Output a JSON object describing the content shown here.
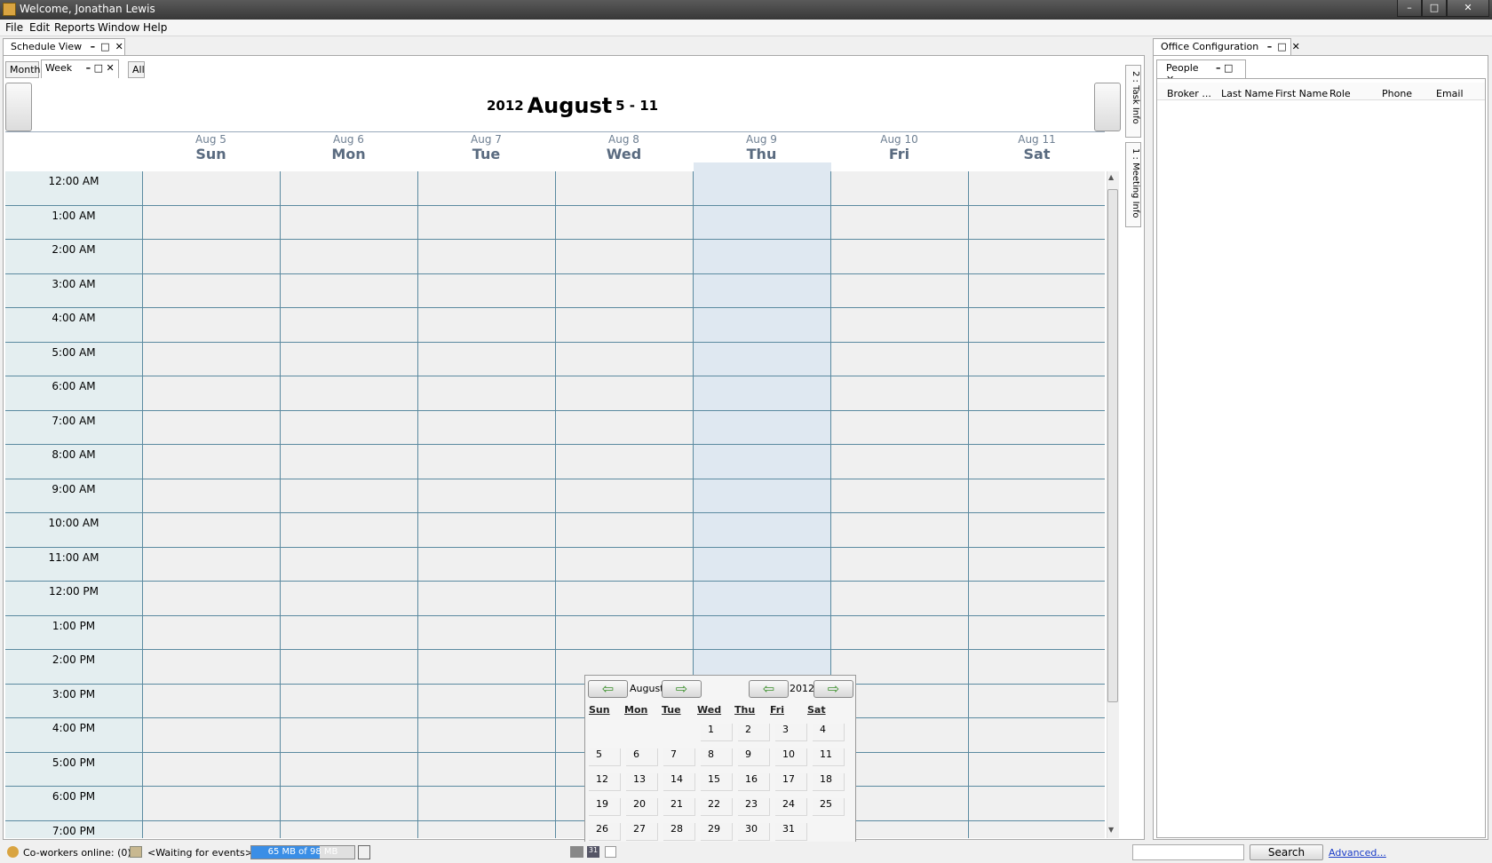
{
  "window": {
    "title": "Welcome, Jonathan Lewis",
    "controls": [
      "–",
      "□",
      "✕"
    ]
  },
  "menu": [
    "File",
    "Edit",
    "Reports",
    "Window",
    "Help"
  ],
  "schedule": {
    "tab_label": "Schedule View",
    "subtabs": [
      "Month",
      "Week",
      "All"
    ],
    "header": {
      "year": "2012",
      "month": "August",
      "range": "5 - 11"
    },
    "days": [
      {
        "date": "Aug 5",
        "weekday": "Sun"
      },
      {
        "date": "Aug 6",
        "weekday": "Mon"
      },
      {
        "date": "Aug 7",
        "weekday": "Tue"
      },
      {
        "date": "Aug 8",
        "weekday": "Wed"
      },
      {
        "date": "Aug 9",
        "weekday": "Thu"
      },
      {
        "date": "Aug 10",
        "weekday": "Fri"
      },
      {
        "date": "Aug 11",
        "weekday": "Sat"
      }
    ],
    "highlighted_day_index": 4,
    "times": [
      "12:00 AM",
      "1:00 AM",
      "2:00 AM",
      "3:00 AM",
      "4:00 AM",
      "5:00 AM",
      "6:00 AM",
      "7:00 AM",
      "8:00 AM",
      "9:00 AM",
      "10:00 AM",
      "11:00 AM",
      "12:00 PM",
      "1:00 PM",
      "2:00 PM",
      "3:00 PM",
      "4:00 PM",
      "5:00 PM",
      "6:00 PM",
      "7:00 PM"
    ],
    "side_tabs": [
      "2 : Task Info",
      "1 : Meeting Info"
    ]
  },
  "minical": {
    "month": "August",
    "year": "2012",
    "dow": [
      "Sun",
      "Mon",
      "Tue",
      "Wed",
      "Thu",
      "Fri",
      "Sat"
    ],
    "weeks": [
      [
        "",
        "",
        "",
        "1",
        "2",
        "3",
        "4"
      ],
      [
        "5",
        "6",
        "7",
        "8",
        "9",
        "10",
        "11"
      ],
      [
        "12",
        "13",
        "14",
        "15",
        "16",
        "17",
        "18"
      ],
      [
        "19",
        "20",
        "21",
        "22",
        "23",
        "24",
        "25"
      ],
      [
        "26",
        "27",
        "28",
        "29",
        "30",
        "31",
        ""
      ]
    ]
  },
  "office": {
    "tab_label": "Office Configuration",
    "subtab": "People",
    "columns": [
      "Broker ...",
      "Last Name",
      "First Name",
      "Role",
      "Phone",
      "Email"
    ]
  },
  "status": {
    "coworkers": "Co-workers online: (0)",
    "events": "<Waiting for events>",
    "memory": "65 MB of 98 MB",
    "memory_fraction": 0.66,
    "search_button": "Search",
    "advanced_link": "Advanced..."
  },
  "colors": {
    "accent": "#5b8aa0",
    "today_bg": "#dfe8f1",
    "time_col_bg": "#e4eef0",
    "mem_bar": "#3a8ee6"
  }
}
